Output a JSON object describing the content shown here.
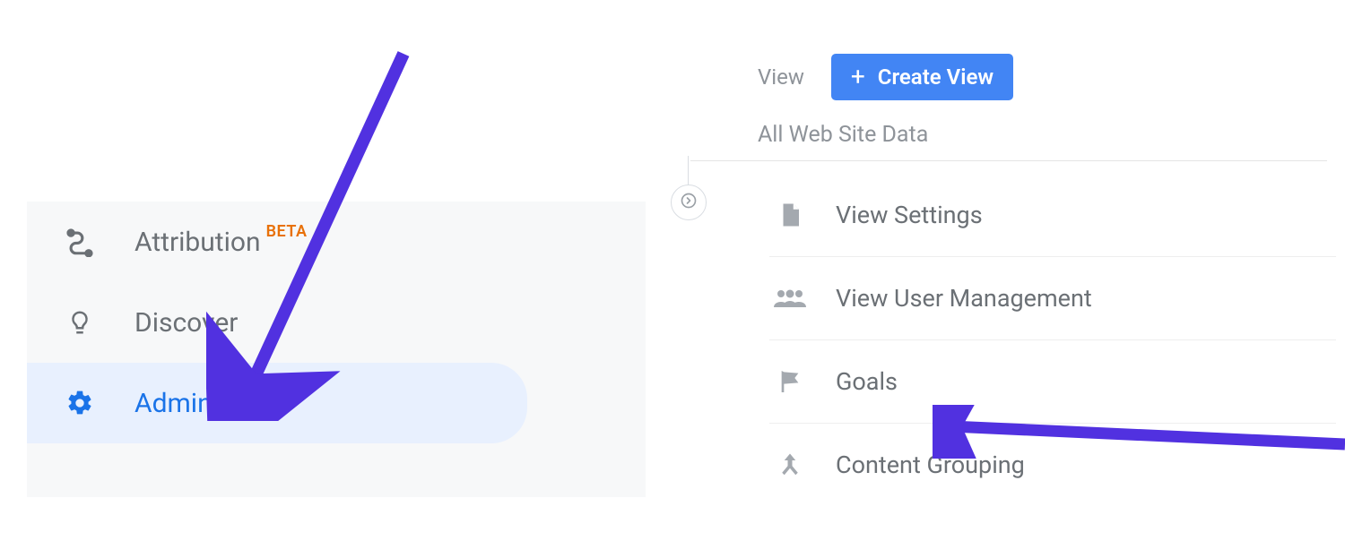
{
  "sidebar": {
    "items": [
      {
        "label": "Attribution",
        "badge": "BETA",
        "icon": "attribution-icon",
        "active": false
      },
      {
        "label": "Discover",
        "icon": "lightbulb-icon",
        "active": false
      },
      {
        "label": "Admin",
        "icon": "gear-icon",
        "active": true
      }
    ]
  },
  "view_column": {
    "section_label": "View",
    "create_button_label": "Create View",
    "current_view_name": "All Web Site Data",
    "items": [
      {
        "label": "View Settings",
        "icon": "document-icon"
      },
      {
        "label": "View User Management",
        "icon": "users-icon"
      },
      {
        "label": "Goals",
        "icon": "flag-icon"
      },
      {
        "label": "Content Grouping",
        "icon": "merge-icon"
      }
    ]
  },
  "annotation": {
    "arrow_color": "#5131e0",
    "arrow1_target": "sidebar-item-admin",
    "arrow2_target": "admin-item-goals"
  }
}
